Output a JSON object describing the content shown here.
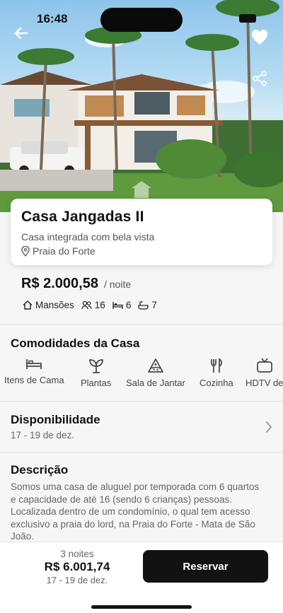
{
  "status_bar": {
    "time": "16:48"
  },
  "listing": {
    "title": "Casa Jangadas II",
    "subtitle": "Casa integrada com bela vista",
    "location": "Praia do Forte",
    "price": "R$ 2.000,58",
    "per_night": "/ noite",
    "specs": [
      {
        "icon": "house-icon",
        "label": "Mansões"
      },
      {
        "icon": "people-icon",
        "label": "16"
      },
      {
        "icon": "bed-icon",
        "label": "6"
      },
      {
        "icon": "bath-icon",
        "label": "7"
      }
    ]
  },
  "amenities": {
    "title": "Comodidades da Casa",
    "items": [
      {
        "icon": "bed-icon",
        "label": "Itens de Cama"
      },
      {
        "icon": "plant-icon",
        "label": "Plantas"
      },
      {
        "icon": "pizza-icon",
        "label": "Sala de Jantar"
      },
      {
        "icon": "utensils-icon",
        "label": "Cozinha"
      },
      {
        "icon": "tv-icon",
        "label": "HDTV de"
      }
    ]
  },
  "availability": {
    "title": "Disponibilidade",
    "dates": "17 - 19 de dez."
  },
  "description": {
    "title": "Descrição",
    "text": "Somos uma casa de aluguel por temporada com 6 quartos e capacidade de até 16 (sendo 6 crianças) pessoas. Localizada dentro de um condomínio, o qual tem acesso exclusivo a praia do lord, na Praia do Forte - Mata de São João."
  },
  "footer": {
    "nights": "3 noites",
    "total": "R$ 6.001,74",
    "dates": "17 - 19 de dez.",
    "reserve_label": "Reservar"
  },
  "colors": {
    "accent": "#121212",
    "background": "#f6f6f7",
    "card": "#ffffff"
  }
}
